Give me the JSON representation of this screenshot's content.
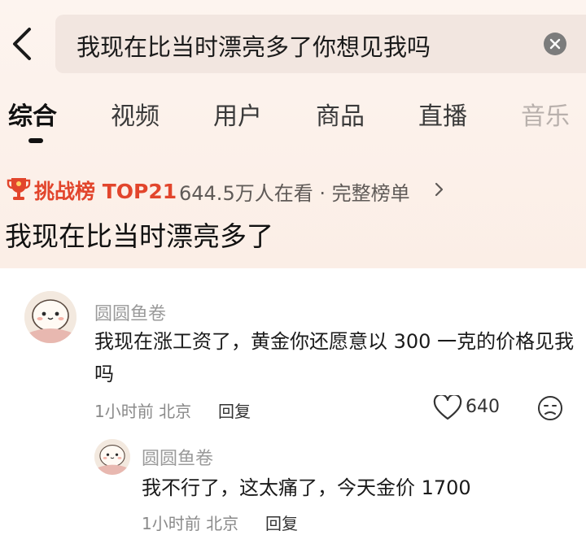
{
  "search": {
    "query": "我现在比当时漂亮多了你想见我吗"
  },
  "tabs": [
    {
      "label": "综合"
    },
    {
      "label": "视频"
    },
    {
      "label": "用户"
    },
    {
      "label": "商品"
    },
    {
      "label": "直播"
    },
    {
      "label": "音乐"
    }
  ],
  "challenge": {
    "title": "挑战榜 TOP21",
    "meta": "644.5万人在看 · 完整榜单"
  },
  "query_title": "我现在比当时漂亮多了",
  "comment": {
    "author": "圆圆鱼卷",
    "text": "我现在涨工资了，黄金你还愿意以 300 一克的价格见我吗",
    "time_location": "1小时前 北京",
    "reply_label": "回复",
    "likes": "640"
  },
  "reply": {
    "author": "圆圆鱼卷",
    "text": "我不行了，这太痛了，今天金价 1700",
    "time_location": "1小时前 北京",
    "reply_label": "回复"
  },
  "colors": {
    "accent_red": "#e2452c",
    "header_bg": "#fbeee6",
    "search_bg": "#f2e6e0"
  }
}
